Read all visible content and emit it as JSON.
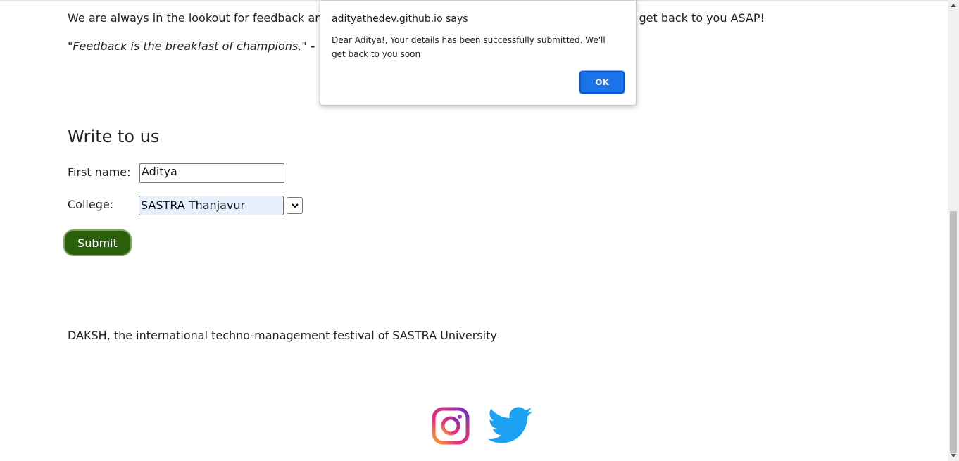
{
  "page": {
    "intro_left": "We are always in the lookout for feedback an",
    "intro_right": "get back to you ASAP!",
    "quote_text": "\"Feedback is the breakfast of champions.\"",
    "quote_author_visible": "- K"
  },
  "contact": {
    "title": "Write to us",
    "first_name_label": "First name:",
    "first_name_value": "Aditya",
    "college_label": "College:",
    "college_value": "SASTRA Thanjavur",
    "submit_label": "Submit"
  },
  "footer": {
    "text": "DAKSH, the international techno-management festival of SASTRA University",
    "social": [
      "instagram-icon",
      "twitter-icon"
    ]
  },
  "dialog": {
    "origin": "adityathedev.github.io says",
    "message": "Dear Aditya!, Your details has been successfully submitted. We'll get back to you soon",
    "ok_label": "OK"
  },
  "colors": {
    "submit_bg": "#2a5f0c",
    "ok_bg": "#1a73e8",
    "autofill_bg": "#e8f0fe",
    "twitter_blue": "#1da1f2"
  }
}
